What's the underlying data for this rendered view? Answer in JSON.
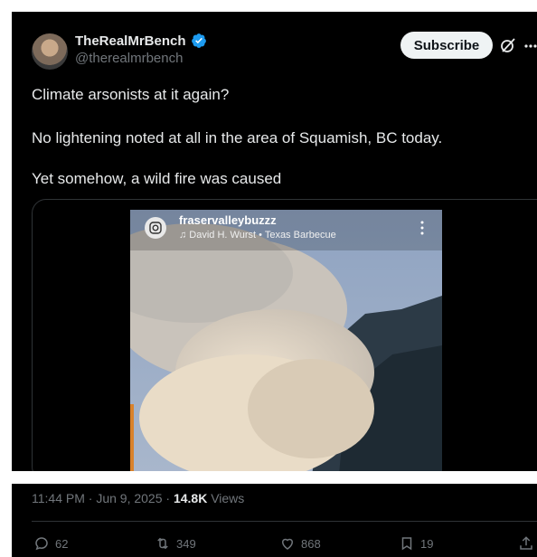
{
  "post": {
    "author_name": "TheRealMrBench",
    "handle": "@therealmrbench",
    "subscribe_label": "Subscribe",
    "text_lines": [
      "Climate arsonists at it again?",
      "No lightening noted at all in the area of Squamish, BC today.",
      "Yet somehow, a wild fire was caused"
    ]
  },
  "video": {
    "account": "fraservalleybuzzz",
    "music": "♫ David H. Wurst • Texas Barbecue"
  },
  "meta": {
    "time": "11:44 PM · Jun 9, 2025 · ",
    "views_count": "14.8K",
    "views_label": " Views"
  },
  "actions": {
    "replies": "62",
    "reposts": "349",
    "likes": "868",
    "bookmarks": "19"
  },
  "icons": [
    "avatar",
    "verified-badge-icon",
    "grok-icon",
    "more-icon",
    "instagram-icon",
    "reply-icon",
    "repost-icon",
    "like-icon",
    "bookmark-icon",
    "share-icon"
  ],
  "colors": {
    "background": "#000000",
    "text": "#e7e9ea",
    "muted": "#71767b",
    "verified": "#1d9bf0",
    "button": "#eff3f4"
  }
}
